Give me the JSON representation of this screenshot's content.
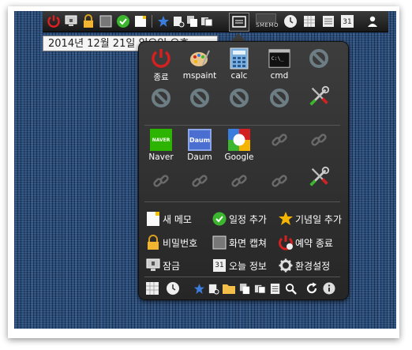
{
  "datetip": {
    "text": "2014년 12월 21일 일요일 오후"
  },
  "taskbar": {
    "smemo_label": "SMEMO",
    "calendar_day": "31"
  },
  "popup": {
    "apps_row1": [
      {
        "label": "종료",
        "icon": "power-icon"
      },
      {
        "label": "mspaint",
        "icon": "palette-icon"
      },
      {
        "label": "calc",
        "icon": "calculator-icon"
      },
      {
        "label": "cmd",
        "icon": "terminal-icon"
      },
      {
        "label": "",
        "icon": "disabled-icon"
      }
    ],
    "apps_row2": [
      {
        "label": "",
        "icon": "disabled-icon"
      },
      {
        "label": "",
        "icon": "disabled-icon"
      },
      {
        "label": "",
        "icon": "disabled-icon"
      },
      {
        "label": "",
        "icon": "disabled-icon"
      },
      {
        "label": "",
        "icon": "tools-icon"
      }
    ],
    "links_row1": [
      {
        "label": "Naver",
        "icon": "naver-icon",
        "badge": "NAVER"
      },
      {
        "label": "Daum",
        "icon": "daum-icon",
        "badge": "Daum"
      },
      {
        "label": "Google",
        "icon": "google-icon",
        "badge": "g"
      },
      {
        "label": "",
        "icon": "link-icon"
      },
      {
        "label": "",
        "icon": "link-icon"
      }
    ],
    "links_row2": [
      {
        "label": "",
        "icon": "link-icon"
      },
      {
        "label": "",
        "icon": "link-icon"
      },
      {
        "label": "",
        "icon": "link-icon"
      },
      {
        "label": "",
        "icon": "link-icon"
      },
      {
        "label": "",
        "icon": "tools-icon"
      }
    ],
    "menu": [
      {
        "label": "새 메모",
        "icon": "memo-icon"
      },
      {
        "label": "일정 추가",
        "icon": "check-icon"
      },
      {
        "label": "기념일 추가",
        "icon": "star-icon"
      },
      {
        "label": "비밀번호",
        "icon": "lock-icon"
      },
      {
        "label": "화면 캡쳐",
        "icon": "capture-icon"
      },
      {
        "label": "예약 종료",
        "icon": "timer-power-icon"
      },
      {
        "label": "잠금",
        "icon": "monitor-lock-icon"
      },
      {
        "label": "오늘 정보",
        "icon": "calendar-icon"
      },
      {
        "label": "환경설정",
        "icon": "settings-icon"
      }
    ],
    "calendar_day": "31"
  },
  "colors": {
    "accent_red": "#d32020",
    "check_green": "#3cb62e",
    "star_gold": "#f4b400",
    "bar_blue": "#3b7ddd"
  }
}
